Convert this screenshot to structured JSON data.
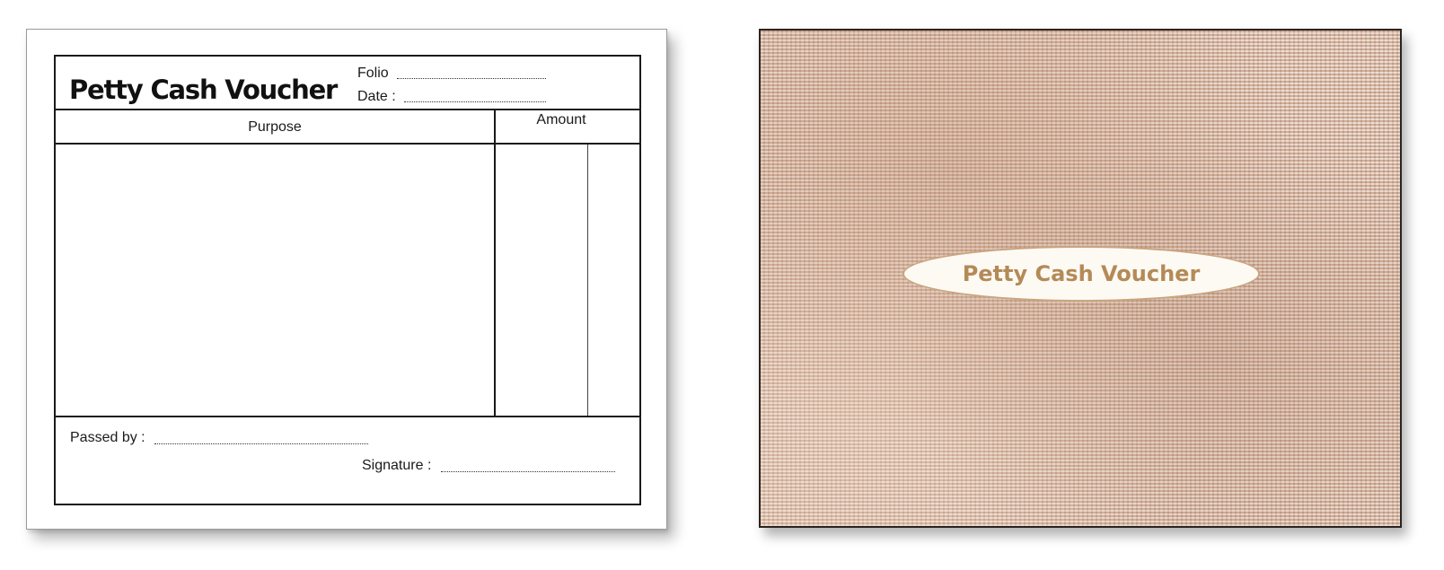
{
  "voucher": {
    "title": "Petty Cash Voucher",
    "folio_label": "Folio",
    "date_label": "Date :",
    "purpose_header": "Purpose",
    "amount_header": "Amount",
    "passed_by_label": "Passed by :",
    "signature_label": "Signature :"
  },
  "cover": {
    "label": "Petty Cash Voucher",
    "colors": {
      "fabric": "#d9b8a2",
      "label_text": "#b48a57"
    }
  }
}
